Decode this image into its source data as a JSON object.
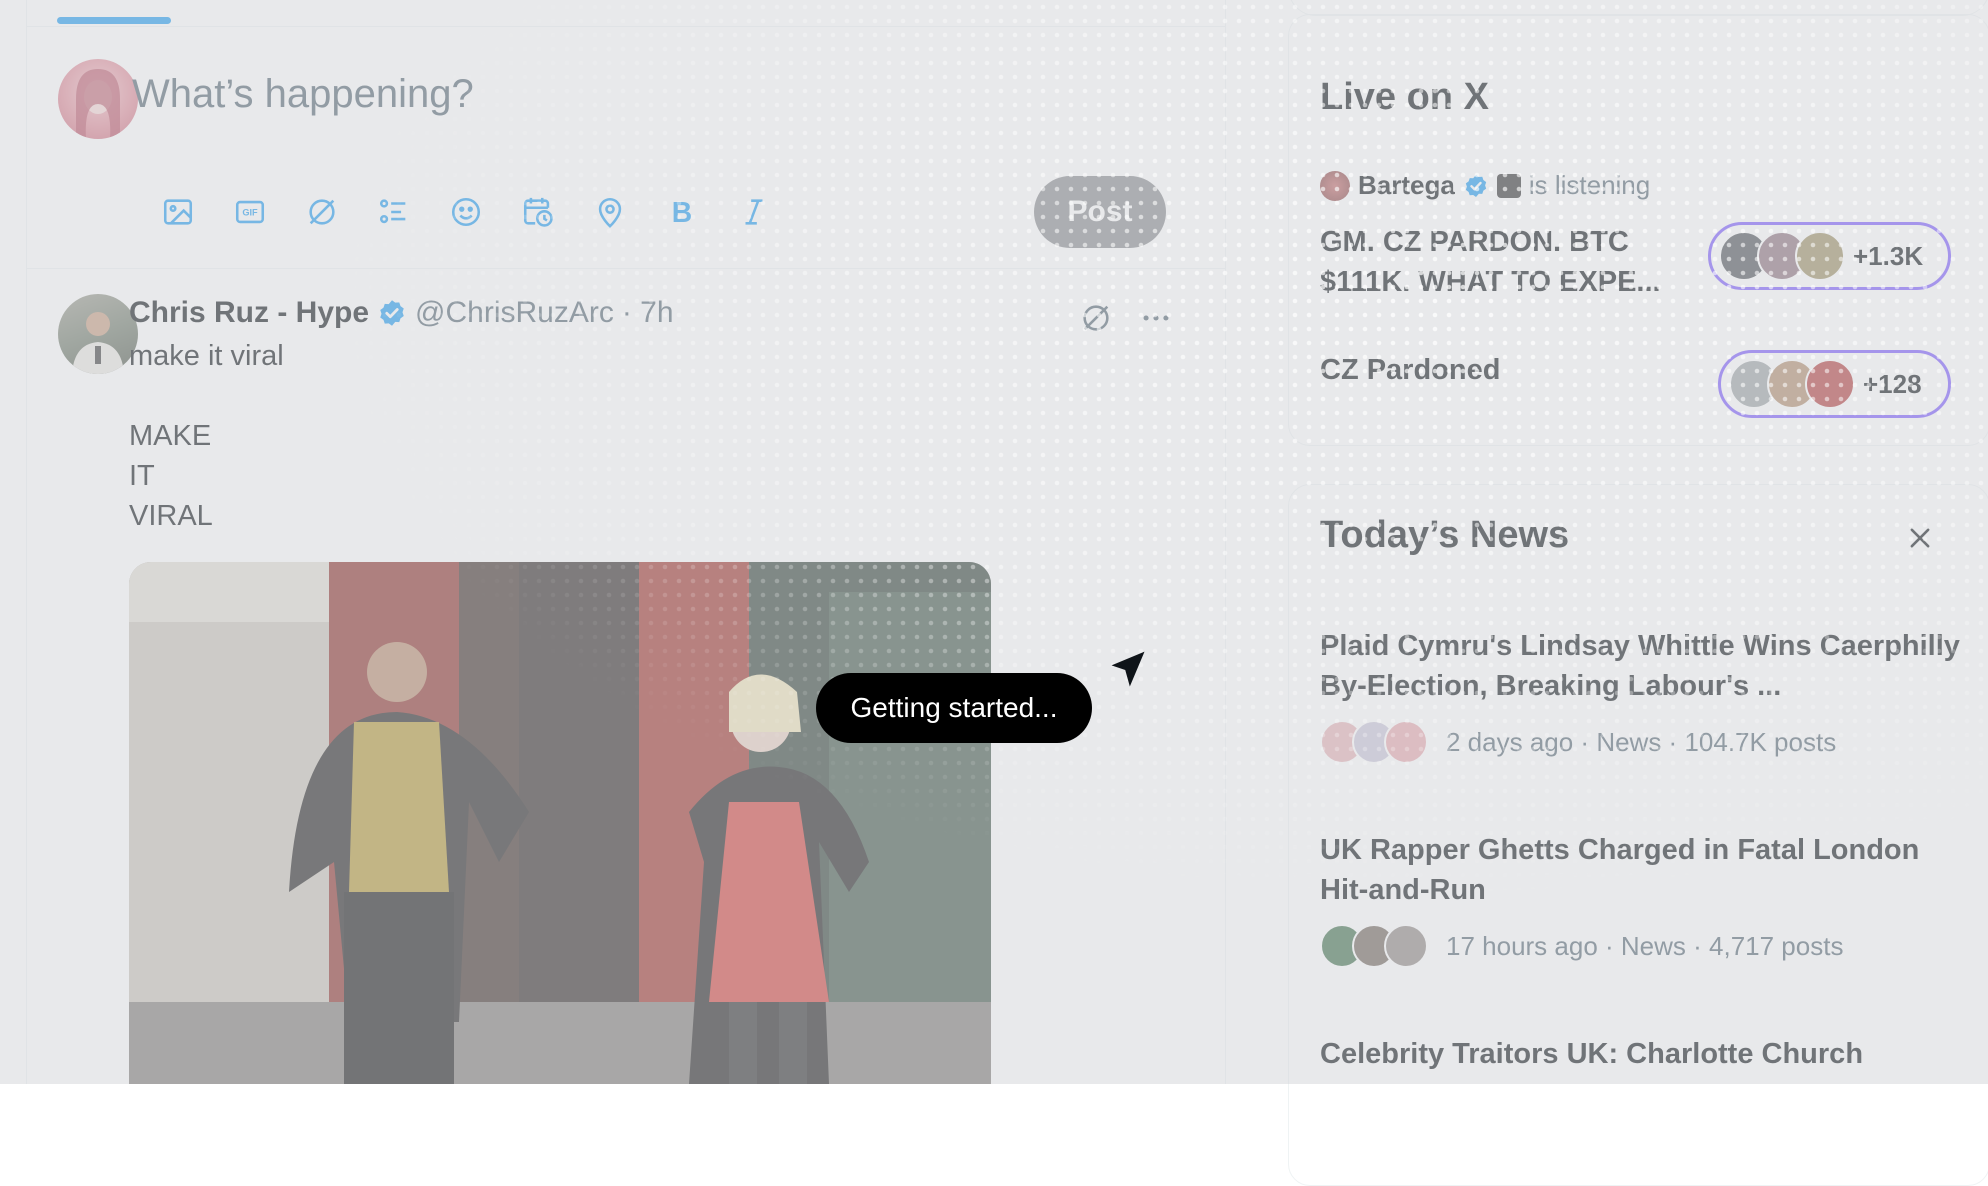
{
  "compose": {
    "placeholder": "What’s happening?",
    "post_label": "Post",
    "tools": [
      "image-icon",
      "gif-icon",
      "grok-icon",
      "poll-icon",
      "emoji-icon",
      "schedule-icon",
      "location-icon",
      "bold-icon",
      "italic-icon"
    ]
  },
  "tweet": {
    "author_name": "Chris Ruz - Hype",
    "verified": true,
    "handle": "@ChrisRuzArc",
    "time": "· 7h",
    "lines": [
      "make it viral",
      "MAKE",
      "IT",
      "VIRAL"
    ]
  },
  "live": {
    "title": "Live on X",
    "host_name": "Bartega",
    "host_status": "is listening",
    "spaces": [
      {
        "title_line1": "GM. CZ PARDON. BTC",
        "title_line2": "$111K. WHAT TO EXPE...",
        "count": "+1.3K"
      },
      {
        "title_line1": "CZ Pardoned",
        "title_line2": "",
        "count": "+128"
      }
    ]
  },
  "news": {
    "title": "Today’s News",
    "items": [
      {
        "title": "Plaid Cymru's Lindsay Whittle Wins Caerphilly By-Election, Breaking Labour's ...",
        "meta": "2 days ago · News · 104.7K posts"
      },
      {
        "title": "UK Rapper Ghetts Charged in Fatal London Hit-and-Run",
        "meta": "17 hours ago · News · 4,717 posts"
      },
      {
        "title": "Celebrity Traitors UK: Charlotte Church",
        "meta": ""
      }
    ]
  },
  "overlay": {
    "tooltip": "Getting started..."
  },
  "colors": {
    "accent": "#1d9bf0",
    "space_border": "#7856ff",
    "overlay_tint": "rgba(215,217,221,0.55)"
  }
}
